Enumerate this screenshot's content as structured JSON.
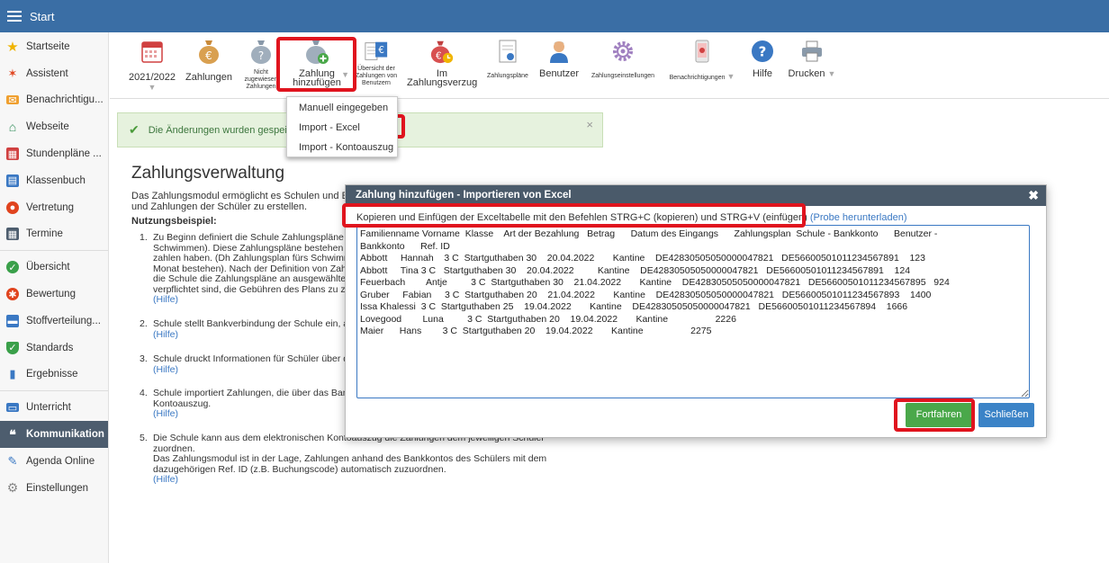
{
  "topbar": {
    "title": "Start"
  },
  "sidebar": {
    "items": [
      {
        "label": "Startseite",
        "icon": "star-icon",
        "color": "#f0b400"
      },
      {
        "label": "Assistent",
        "icon": "wand-icon",
        "color": "#e0441e"
      },
      {
        "label": "Benachrichtigu...",
        "icon": "envelope-icon",
        "color": "#f0a030"
      },
      {
        "label": "Webseite",
        "icon": "home-icon",
        "color": "#2e8b57"
      },
      {
        "label": "Stundenpläne ...",
        "icon": "calendar-grid-icon",
        "color": "#d04040"
      },
      {
        "label": "Klassenbuch",
        "icon": "book-icon",
        "color": "#3a78c3"
      },
      {
        "label": "Vertretung",
        "icon": "person-icon",
        "color": "#e0441e"
      },
      {
        "label": "Termine",
        "icon": "calendar-icon",
        "color": "#4d5d6e"
      },
      {
        "label": "Übersicht",
        "icon": "check-circle-icon",
        "color": "#3aa04a"
      },
      {
        "label": "Bewertung",
        "icon": "rating-icon",
        "color": "#e0441e"
      },
      {
        "label": "Stoffverteilung...",
        "icon": "briefcase-icon",
        "color": "#3a78c3"
      },
      {
        "label": "Standards",
        "icon": "shield-icon",
        "color": "#3aa04a"
      },
      {
        "label": "Ergebnisse",
        "icon": "bar-chart-icon",
        "color": "#3a78c3"
      },
      {
        "label": "Unterricht",
        "icon": "laptop-icon",
        "color": "#3a78c3"
      },
      {
        "label": "Kommunikation",
        "icon": "chat-icon",
        "color": "#ffffff"
      },
      {
        "label": "Agenda Online",
        "icon": "pen-icon",
        "color": "#3a78c3"
      },
      {
        "label": "Einstellungen",
        "icon": "gear-icon",
        "color": "#888888"
      }
    ]
  },
  "toolbar": {
    "year": "2021/2022",
    "zahlungen": "Zahlungen",
    "nicht_zugewiesen": [
      "Nicht",
      "zugewiesen",
      "Zahlungen"
    ],
    "zahlung_hinzufuegen": [
      "Zahlung",
      "hinzufügen"
    ],
    "uebersicht": [
      "Übersicht der",
      "Zahlungen von",
      "Benutzern"
    ],
    "verzug": [
      "Im",
      "Zahlungsverzug"
    ],
    "zahlungsplaene": "Zahlungspläne",
    "benutzer": "Benutzer",
    "einstellungen": "Zahlungseinstellungen",
    "benachrichtigungen": "Benachrichtigungen",
    "hilfe": "Hilfe",
    "drucken": "Drucken"
  },
  "dropdown": {
    "items": [
      "Manuell eingegeben",
      "Import - Excel",
      "Import - Kontoauszug"
    ]
  },
  "alert": {
    "text": "Die Änderungen wurden gespeichert."
  },
  "main": {
    "title": "Zahlungsverwaltung",
    "intro": [
      "Das Zahlungsmodul ermöglicht es Schulen und Elt",
      "und Zahlungen der Schüler zu erstellen."
    ],
    "usage_heading": "Nutzungsbeispiel:",
    "steps": [
      {
        "num": "1.",
        "lines": [
          "Zu Beginn definiert die Schule Zahlungspläne (e",
          "Schwimmen). Diese Zahlungspläne bestehen a",
          "zahlen haben. (Dh Zahlungsplan fürs Schwimm",
          "Monat bestehen). Nach der Definition von Zahlu",
          "die Schule die Zahlungspläne an ausgewählte S",
          "verpflichtet sind, die Gebühren des Plans zu za"
        ],
        "hilfe": "(Hilfe)"
      },
      {
        "num": "2.",
        "lines": [
          "Schule stellt Bankverbindung der Schule ein, au"
        ],
        "hilfe": "(Hilfe)"
      },
      {
        "num": "3.",
        "lines": [
          "Schule druckt Informationen für Schüler über di"
        ],
        "hilfe": "(Hilfe)"
      },
      {
        "num": "4.",
        "lines": [
          "Schule importiert Zahlungen, die über das Bank",
          "Kontoauszug."
        ],
        "hilfe": "(Hilfe)"
      },
      {
        "num": "5.",
        "lines": [
          "Die Schule kann aus dem elektronischen Kontoauszug die Zahlungen dem jeweiligen Schüler zuordnen.",
          "Das Zahlungsmodul ist in der Lage, Zahlungen anhand des Bankkontos des Schülers mit dem",
          "dazugehörigen Ref. ID (z.B. Buchungscode) automatisch zuzuordnen."
        ],
        "hilfe": "(Hilfe)"
      }
    ]
  },
  "dialog": {
    "title": "Zahlung hinzufügen - Importieren von Excel",
    "instruction": "Kopieren und Einfügen der Exceltabelle mit den Befehlen STRG+C (kopieren) und STRG+V (einfügen)",
    "download_link": "(Probe herunterladen)",
    "textarea_value": "Familienname Vorname  Klasse    Art der Bezahlung   Betrag      Datum des Eingangs      Zahlungsplan  Schule - Bankkonto      Benutzer -\nBankkonto      Ref. ID\nAbbott     Hannah    3 C  Startguthaben 30    20.04.2022       Kantine    DE42830505050000047821   DE56600501011234567891    123\nAbbott     Tina 3 C   Startguthaben 30    20.04.2022         Kantine    DE42830505050000047821   DE56600501011234567891    124\nFeuerbach        Antje         3 C  Startguthaben 30    21.04.2022       Kantine    DE42830505050000047821   DE56600501011234567895   924\nGruber     Fabian     3 C  Startguthaben 20    21.04.2022       Kantine    DE42830505050000047821   DE56600501011234567893    1400\nIssa Khalessi  3 C  Startguthaben 25    19.04.2022       Kantine    DE42830505050000047821   DE56600501011234567894    1666\nLovegood        Luna         3 C  Startguthaben 20    19.04.2022       Kantine                  2226\nMaier      Hans        3 C  Startguthaben 20    19.04.2022       Kantine                  2275",
    "continue_label": "Fortfahren",
    "close_label": "Schließen"
  }
}
